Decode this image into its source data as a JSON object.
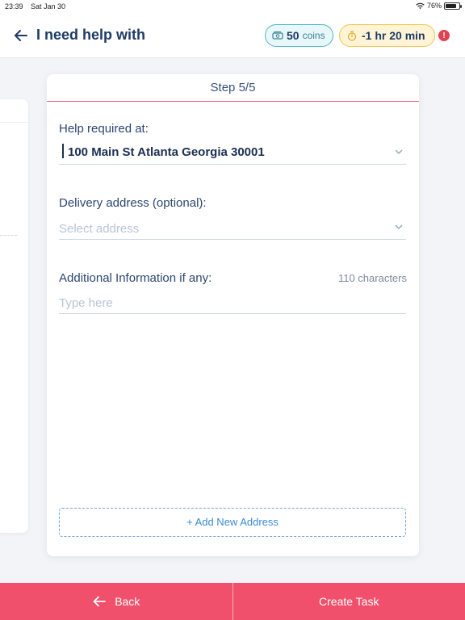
{
  "status_bar": {
    "time": "23:39",
    "date": "Sat Jan 30",
    "battery": "76%"
  },
  "header": {
    "title": "I need help with",
    "coins_value": "50",
    "coins_label": "coins",
    "timer_value": "-1 hr 20 min",
    "alert_symbol": "!"
  },
  "form": {
    "step": "Step 5/5",
    "help_label": "Help required at:",
    "help_value": "100 Main St Atlanta Georgia 30001",
    "delivery_label": "Delivery address (optional):",
    "delivery_placeholder": "Select address",
    "info_label": "Additional Information if any:",
    "info_char_count": "110  characters",
    "info_placeholder": "Type here",
    "add_address_label": "+ Add New Address"
  },
  "footer": {
    "back_label": "Back",
    "create_label": "Create Task"
  },
  "colors": {
    "accent": "#f0506b",
    "coins_border": "#4ab8c7",
    "timer_border": "#f0c54a",
    "alert": "#e2424f",
    "link_blue": "#3a8bcf"
  }
}
